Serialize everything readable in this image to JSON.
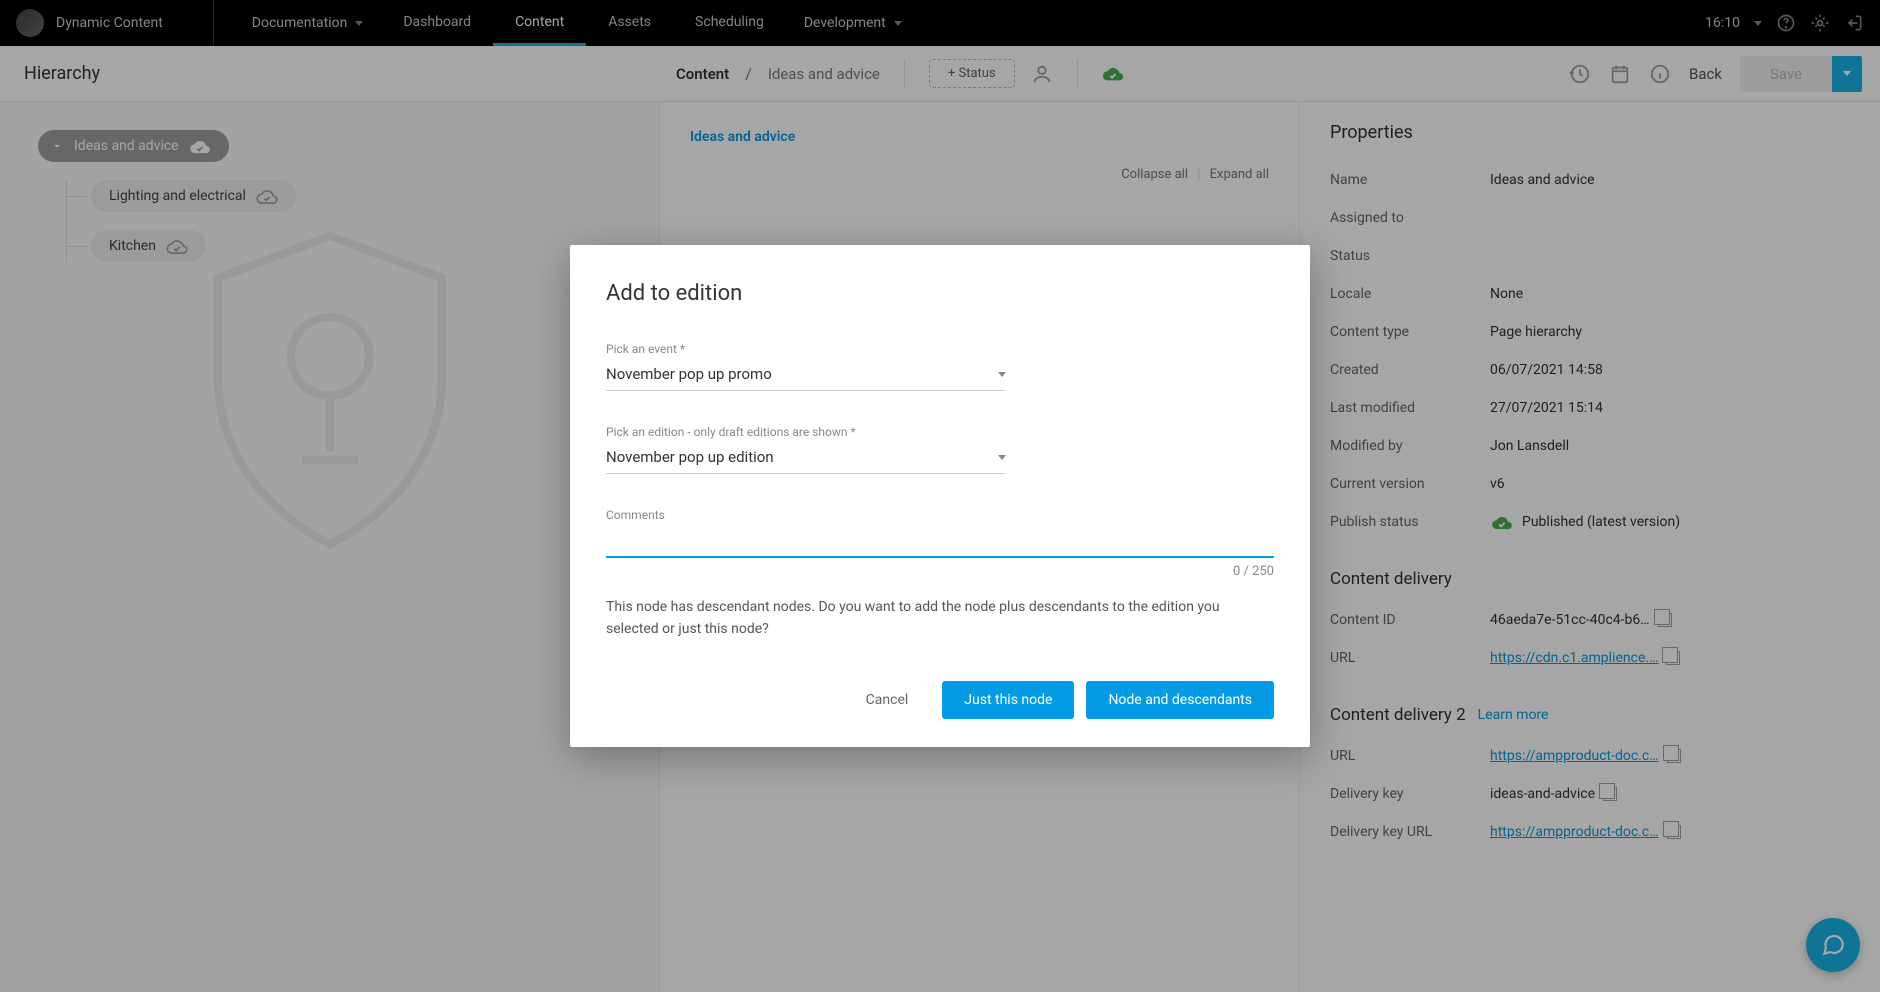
{
  "brand": "Dynamic Content",
  "topDropdown1": "Documentation",
  "topNav": [
    "Dashboard",
    "Content",
    "Assets",
    "Scheduling"
  ],
  "topNavActive": "Content",
  "topDropdown2": "Development",
  "clock": "16:10",
  "hierarchyTitle": "Hierarchy",
  "crumb": {
    "root": "Content",
    "sep": "/",
    "current": "Ideas and advice"
  },
  "statusChip": "+ Status",
  "back": "Back",
  "save": "Save",
  "tree": {
    "root": "Ideas and advice",
    "children": [
      "Lighting and electrical",
      "Kitchen"
    ]
  },
  "mid": {
    "titleLink": "Ideas and advice",
    "collapse": "Collapse all",
    "expand": "Expand all"
  },
  "properties": {
    "title": "Properties",
    "rows": {
      "name_k": "Name",
      "name_v": "Ideas and advice",
      "assigned_k": "Assigned to",
      "assigned_v": "",
      "status_k": "Status",
      "status_v": "",
      "locale_k": "Locale",
      "locale_v": "None",
      "ctype_k": "Content type",
      "ctype_v": "Page hierarchy",
      "created_k": "Created",
      "created_v": "06/07/2021 14:58",
      "modified_k": "Last modified",
      "modified_v": "27/07/2021 15:14",
      "modby_k": "Modified by",
      "modby_v": "Jon Lansdell",
      "ver_k": "Current version",
      "ver_v": "v6",
      "pub_k": "Publish status",
      "pub_v": "Published (latest version)"
    },
    "delivery1": {
      "title": "Content delivery",
      "cid_k": "Content ID",
      "cid_v": "46aeda7e-51cc-40c4-b6…",
      "url_k": "URL",
      "url_v": "https://cdn.c1.amplience.…"
    },
    "delivery2": {
      "title": "Content delivery 2",
      "learn": "Learn more",
      "url_k": "URL",
      "url_v": "https://ampproduct-doc.c…",
      "dkey_k": "Delivery key",
      "dkey_v": "ideas-and-advice",
      "dkeyurl_k": "Delivery key URL",
      "dkeyurl_v": "https://ampproduct-doc.c…"
    }
  },
  "modal": {
    "title": "Add to edition",
    "event_label": "Pick an event *",
    "event_value": "November pop up promo",
    "edition_label": "Pick an edition - only draft editions are shown *",
    "edition_value": "November pop up edition",
    "comments_label": "Comments",
    "comments_value": "",
    "counter": "0 / 250",
    "body": "This node has descendant nodes. Do you want to add the node plus descendants to the edition you selected or just this node?",
    "cancel": "Cancel",
    "just": "Just this node",
    "nodeAndDesc": "Node and descendants"
  }
}
